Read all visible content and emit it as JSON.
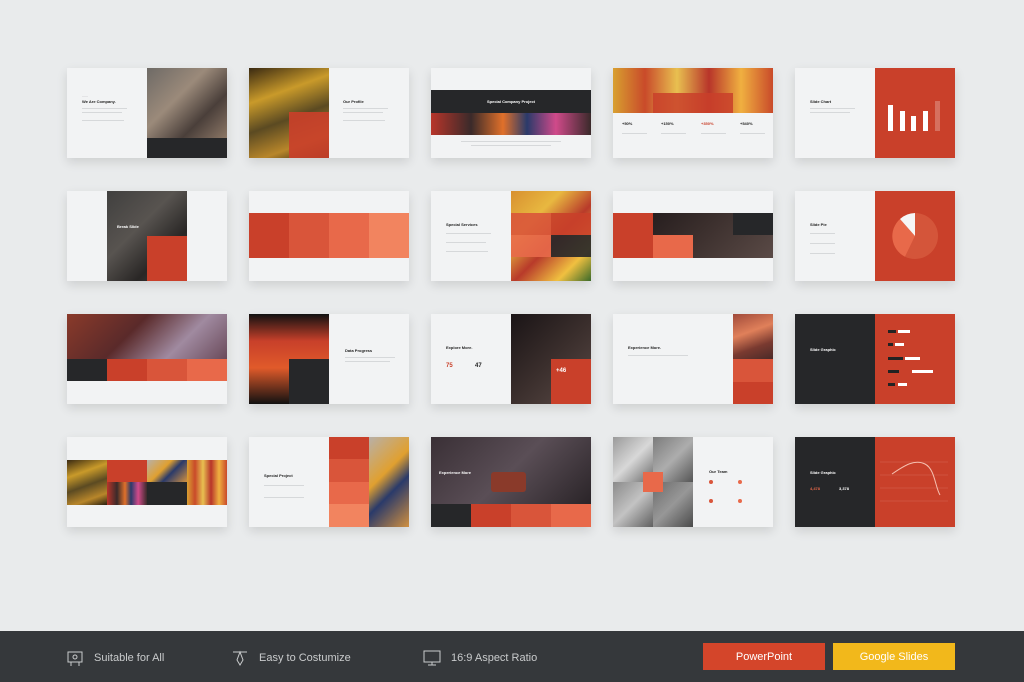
{
  "slides": [
    {
      "title": "We Are Company."
    },
    {
      "title": "Our Profile"
    },
    {
      "title": "Special Company Project"
    },
    {
      "stats": [
        "+50%",
        "+150%",
        "+350%",
        "+540%"
      ]
    },
    {
      "title": "Slide Chart"
    },
    {
      "title": "Break Slide"
    },
    {
      "title": ""
    },
    {
      "title": "Special Services"
    },
    {
      "title": ""
    },
    {
      "title": "Slide Pie"
    },
    {
      "title": ""
    },
    {
      "title": "Data Progress"
    },
    {
      "title": "Explore More.",
      "stat1": "75",
      "stat2": "47",
      "stat3": "+46"
    },
    {
      "title": "Experience More."
    },
    {
      "title": "Slide Graphic"
    },
    {
      "title": ""
    },
    {
      "title": "Special Project"
    },
    {
      "title": "Experience More"
    },
    {
      "title": "Our Team"
    },
    {
      "title": "Slide Graphic",
      "stat1": "4,478",
      "stat2": "3,378"
    }
  ],
  "features": [
    {
      "label": "Suitable for All",
      "icon": "presentation-board-icon"
    },
    {
      "label": "Easy to Costumize",
      "icon": "pen-tool-icon"
    },
    {
      "label": "16:9 Aspect Ratio",
      "icon": "monitor-icon"
    }
  ],
  "buttons": {
    "powerpoint": "PowerPoint",
    "google_slides": "Google Slides"
  },
  "colors": {
    "accent": "#c9402a",
    "background": "#e9ebec",
    "bar": "#35383b",
    "powerpoint": "#d4452a",
    "google_slides": "#f2b81b"
  }
}
